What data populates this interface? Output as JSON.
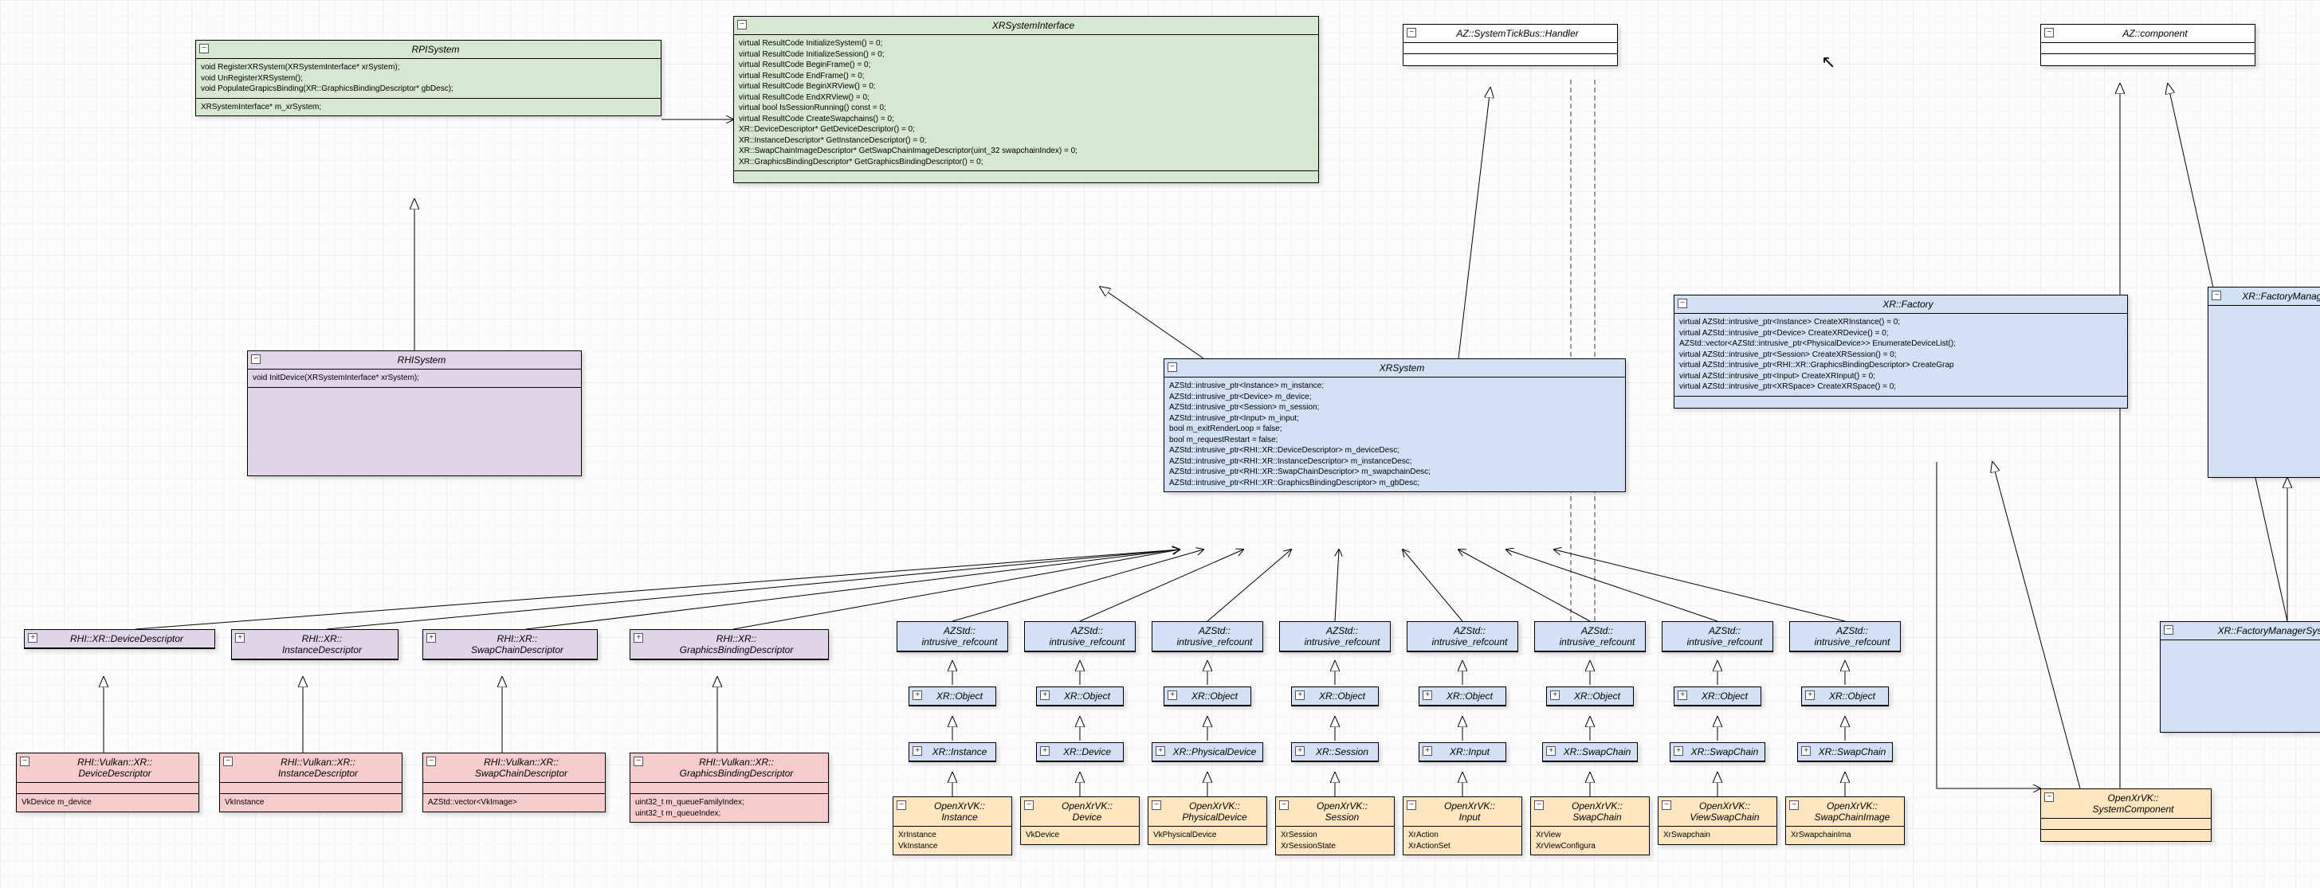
{
  "classes": {
    "rpi": {
      "title": "RPISystem",
      "ops": "void RegisterXRSystem(XRSystemInterface* xrSystem);\nvoid UnRegisterXRSystem();\nvoid PopulateGrapicsBinding(XR::GraphicsBindingDescriptor* gbDesc);",
      "attrs": "XRSystemInterface* m_xrSystem;"
    },
    "rhi": {
      "title": "RHISystem",
      "ops": "void InitDevice(XRSystemInterface* xrSystem);"
    },
    "xrsi": {
      "title": "XRSystemInterface",
      "ops": "virtual ResultCode InitializeSystem() = 0;\nvirtual ResultCode InitializeSession() = 0;\nvirtual ResultCode BeginFrame() = 0;\nvirtual ResultCode EndFrame() = 0;\nvirtual ResultCode BeginXRView() = 0;\nvirtual ResultCode EndXRView() = 0;\nvirtual bool IsSessionRunning() const = 0;\nvirtual ResultCode CreateSwapchains() = 0;\nXR::DeviceDescriptor* GetDeviceDescriptor() = 0;\nXR::InstanceDescriptor* GetInstanceDescriptor() = 0;\nXR::SwapChainImageDescriptor* GetSwapChainImageDescriptor(uint_32 swapchainIndex) = 0;\nXR::GraphicsBindingDescriptor* GetGraphicsBindingDescriptor() = 0;"
    },
    "xrsys": {
      "title": "XRSystem",
      "attrs": "AZStd::intrusive_ptr<Instance> m_instance;\nAZStd::intrusive_ptr<Device> m_device;\nAZStd::intrusive_ptr<Session> m_session;\nAZStd::intrusive_ptr<Input> m_input;\nbool m_exitRenderLoop = false;\nbool m_requestRestart = false;\nAZStd::intrusive_ptr<RHI::XR::DeviceDescriptor> m_deviceDesc;\nAZStd::intrusive_ptr<RHI::XR::InstanceDescriptor> m_instanceDesc;\nAZStd::intrusive_ptr<RHI::XR::SwapChainDescriptor> m_swapchainDesc;\nAZStd::intrusive_ptr<RHI::XR::GraphicsBindingDescriptor> m_gbDesc;"
    },
    "tick": {
      "title": "AZ::SystemTickBus::Handler"
    },
    "azcomp": {
      "title": "AZ::component"
    },
    "xrfac": {
      "title": "XR::Factory",
      "ops": "virtual AZStd::intrusive_ptr<Instance> CreateXRInstance() = 0;\nvirtual AZStd::intrusive_ptr<Device> CreateXRDevice() = 0;\nAZStd::vector<AZStd::intrusive_ptr<PhysicalDevice>> EnumerateDeviceList();\nvirtual AZStd::intrusive_ptr<Session> CreateXRSession() = 0;\nvirtual AZStd::intrusive_ptr<RHI::XR::GraphicsBindingDescriptor> CreateGrap\nvirtual AZStd::intrusive_ptr<Input> CreateXRInput() = 0;\nvirtual AZStd::intrusive_ptr<XRSpace> CreateXRSpace() = 0;"
    },
    "xrfmb": {
      "title": "XR::FactoryManagerBus"
    },
    "xrfmsc": {
      "title": "XR::FactoryManagerSystemComponent"
    },
    "descDev": {
      "title": "RHI::XR::DeviceDescriptor",
      "expand": "+"
    },
    "descInst": {
      "title": "RHI::XR::\nInstanceDescriptor"
    },
    "descSC": {
      "title": "RHI::XR::\nSwapChainDescriptor"
    },
    "descGB": {
      "title": "RHI::XR::\nGraphicsBindingDescriptor"
    },
    "vkDev": {
      "title": "RHI::Vulkan::XR::\nDeviceDescriptor",
      "attrs": "VkDevice m_device"
    },
    "vkInst": {
      "title": "RHI::Vulkan::XR::\nInstanceDescriptor",
      "attrs": "VkInstance"
    },
    "vkSC": {
      "title": "RHI::Vulkan::XR::\nSwapChainDescriptor",
      "attrs": "AZStd::vector<VkImage>"
    },
    "vkGB": {
      "title": "RHI::Vulkan::XR::\nGraphicsBindingDescriptor",
      "attrs": "uint32_t m_queueFamilyIndex;\nuint32_t m_queueIndex;"
    },
    "refc": "AZStd::\nintrusive_refcount",
    "xobj": "XR::Object",
    "xinst": "XR::Instance",
    "xdev": "XR::Device",
    "xpd": "XR::PhysicalDevice",
    "xsess": "XR::Session",
    "xinput": "XR::Input",
    "xsc": "XR::SwapChain",
    "ovxInst": {
      "title": "OpenXrVK::\nInstance",
      "attrs": "XrInstance\nVkInstance"
    },
    "ovxDev": {
      "title": "OpenXrVK::\nDevice",
      "attrs": "VkDevice"
    },
    "ovxPD": {
      "title": "OpenXrVK::\nPhysicalDevice",
      "attrs": "VkPhysicalDevice"
    },
    "ovxSess": {
      "title": "OpenXrVK::\nSession",
      "attrs": "XrSession\nXrSessionState"
    },
    "ovxIn": {
      "title": "OpenXrVK::\nInput",
      "attrs": "XrAction\nXrActionSet"
    },
    "ovxSC": {
      "title": "OpenXrVK::\nSwapChain",
      "attrs": "XrView\nXrViewConfigura"
    },
    "ovxVSC": {
      "title": "OpenXrVK::\nViewSwapChain",
      "attrs": "XrSwapchain"
    },
    "ovxSCI": {
      "title": "OpenXrVK::\nSwapChainImage",
      "attrs": "XrSwapchainIma"
    },
    "ovxSysC": {
      "title": "OpenXrVK::\nSystemComponent"
    }
  }
}
